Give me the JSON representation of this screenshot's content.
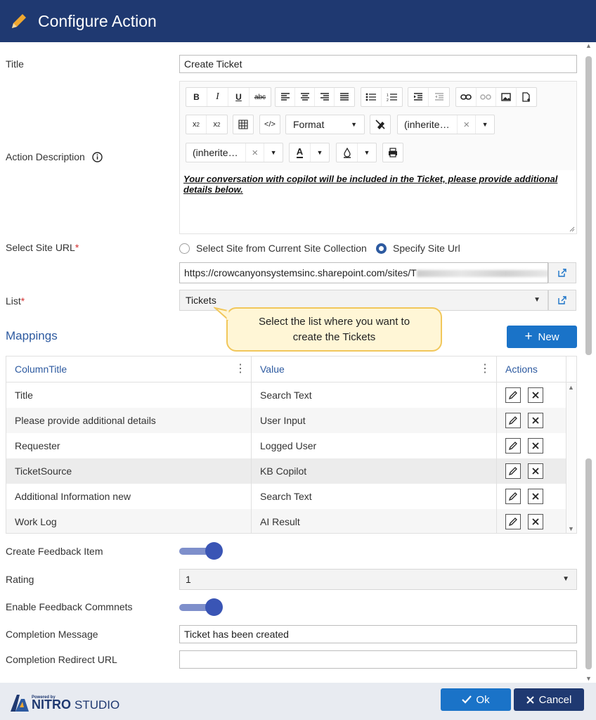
{
  "header": {
    "title": "Configure Action"
  },
  "form": {
    "title_label": "Title",
    "title_value": "Create Ticket",
    "description_label": "Action Description",
    "toolbar": {
      "format": "Format",
      "font_family": "(inherite…",
      "font_size": "(inherite…"
    },
    "description_text": "Your conversation with copilot will be included in the Ticket, please provide additional details below.",
    "site_url_label": "Select Site URL",
    "required_mark": "*",
    "site_option_1": "Select Site from Current Site Collection",
    "site_option_2": "Specify Site Url",
    "site_url_value": "https://crowcanyonsystemsinc.sharepoint.com/sites/T",
    "list_label": "List",
    "list_value": "Tickets"
  },
  "callout": {
    "line1": "Select the list where you want to",
    "line2": "create the Tickets"
  },
  "mappings": {
    "title": "Mappings",
    "new_button": "New",
    "columns": [
      "ColumnTitle",
      "Value",
      "Actions"
    ],
    "rows": [
      {
        "column": "Title",
        "value": "Search Text"
      },
      {
        "column": "Please provide additional details",
        "value": "User Input"
      },
      {
        "column": "Requester",
        "value": "Logged User"
      },
      {
        "column": "TicketSource",
        "value": "KB Copilot"
      },
      {
        "column": "Additional Information new",
        "value": "Search Text"
      },
      {
        "column": "Work Log",
        "value": "AI Result"
      }
    ]
  },
  "feedback": {
    "create_label": "Create Feedback Item",
    "create_on": true,
    "rating_label": "Rating",
    "rating_value": "1",
    "comments_label": "Enable Feedback Commnets",
    "comments_on": true,
    "completion_label": "Completion Message",
    "completion_value": "Ticket has been created",
    "redirect_label": "Completion Redirect URL",
    "redirect_value": ""
  },
  "footer": {
    "powered_by": "Powered by",
    "brand_1": "NITRO",
    "brand_2": "STUDIO",
    "ok": "Ok",
    "cancel": "Cancel"
  },
  "colors": {
    "header": "#1f3971",
    "accent": "#1a73c8",
    "link": "#2d5aa0"
  }
}
